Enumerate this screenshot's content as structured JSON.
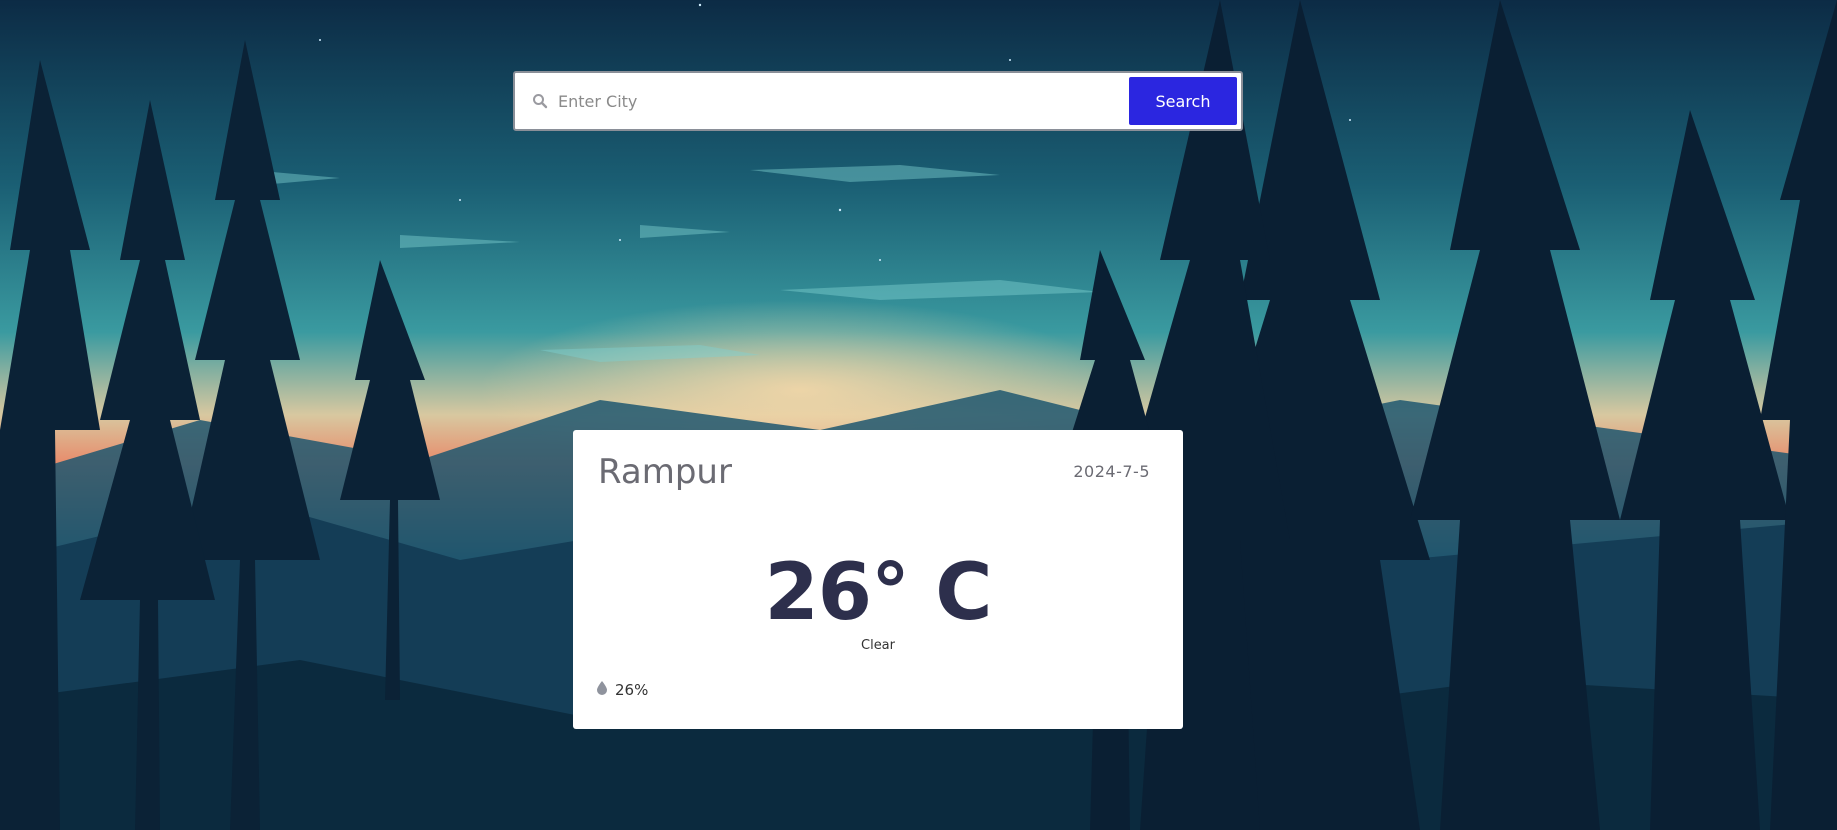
{
  "search": {
    "placeholder": "Enter City",
    "value": "",
    "button_label": "Search",
    "button_color": "#2b26e0"
  },
  "weather": {
    "city": "Rampur",
    "date": "2024-7-5",
    "temperature": "26° C",
    "condition": "Clear",
    "humidity": "26%"
  },
  "icons": {
    "search": "search-icon",
    "humidity": "water-drop-icon"
  },
  "colors": {
    "card_background": "#ffffff",
    "temperature_text": "#2d2f4c",
    "secondary_text": "#6b6b73"
  }
}
